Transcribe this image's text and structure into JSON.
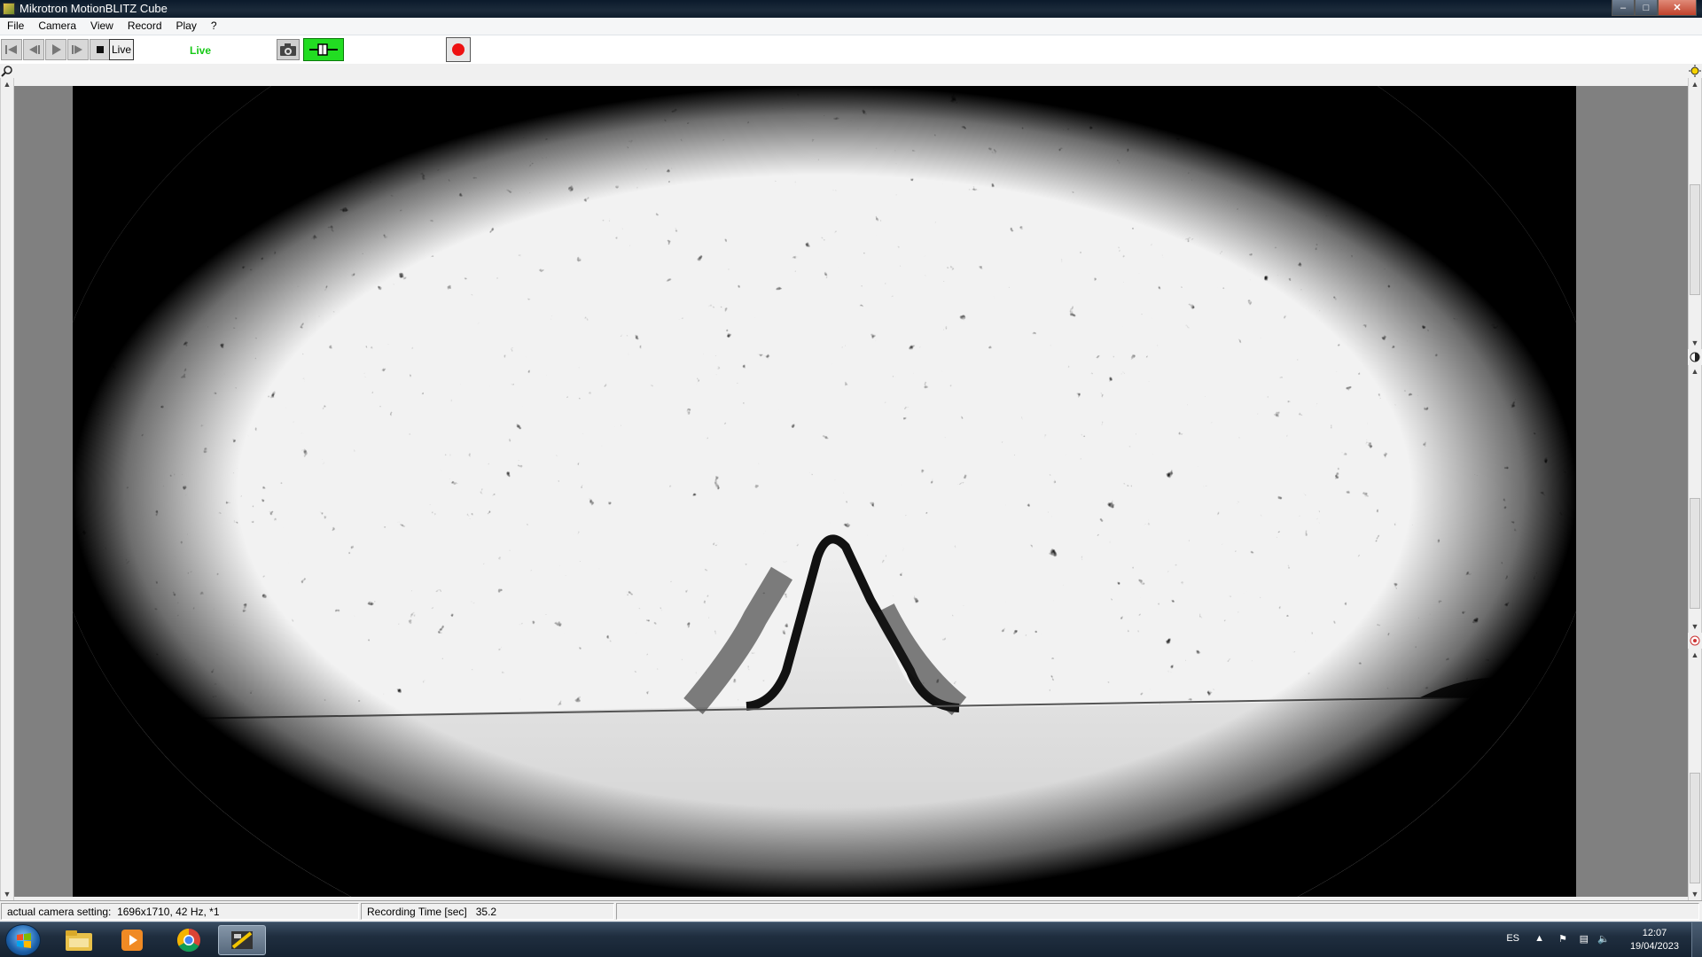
{
  "window": {
    "title": "Mikrotron MotionBLITZ Cube",
    "minimize_label": "–",
    "maximize_label": "□",
    "close_label": "✕"
  },
  "menu": [
    "File",
    "Camera",
    "View",
    "Record",
    "Play",
    "?"
  ],
  "toolbar": {
    "live_button_label": "Live",
    "live_status": "Live",
    "colors": {
      "live_status": "#16c916",
      "trigger_active": "#22dd22",
      "record_dot": "#ee1111"
    },
    "icons": [
      "skip-to-start-icon",
      "step-back-icon",
      "play-icon",
      "step-forward-icon",
      "stop-icon",
      "camera-snapshot-icon",
      "trigger-icon",
      "record-icon",
      "zoom-icon",
      "brightness-icon"
    ]
  },
  "statusbar": {
    "camera_setting_label": "actual camera setting:",
    "camera_setting_value": "1696x1710, 42 Hz, *1",
    "recording_time_label": "Recording Time [sec]",
    "recording_time_value": "35.2"
  },
  "taskbar": {
    "apps": [
      "windows-start-icon",
      "file-explorer-icon",
      "media-player-icon",
      "chrome-icon",
      "motionblitz-icon"
    ],
    "language": "ES",
    "time": "12:07",
    "date": "19/04/2023"
  }
}
